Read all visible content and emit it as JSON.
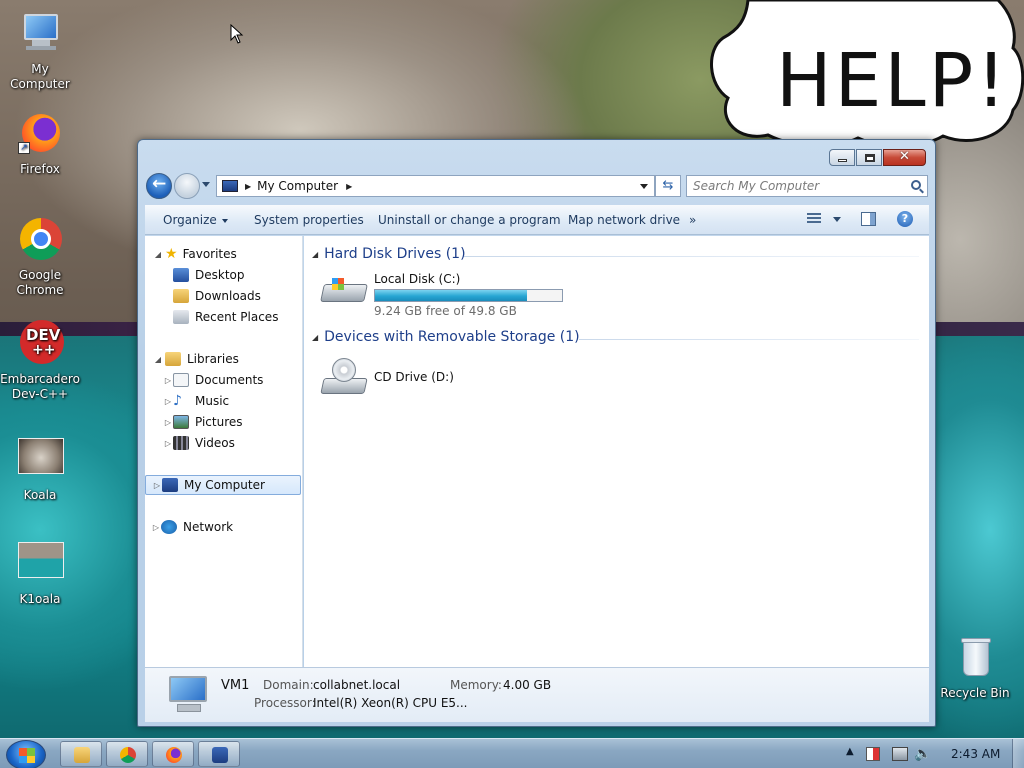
{
  "desktop": {
    "icons": [
      {
        "label": "My Computer"
      },
      {
        "label": "Firefox"
      },
      {
        "label": "Google Chrome"
      },
      {
        "label": "Embarcadero Dev-C++"
      },
      {
        "label": "Koala"
      },
      {
        "label": "K1oala"
      },
      {
        "label": "Recycle Bin"
      }
    ],
    "dev_badge": "DEV",
    "dev_badge2": "++",
    "help_text": "HELP!"
  },
  "window": {
    "address": {
      "location": "My Computer",
      "search_placeholder": "Search My Computer"
    },
    "command_bar": {
      "organize": "Organize",
      "system_properties": "System properties",
      "uninstall": "Uninstall or change a program",
      "map_drive": "Map network drive",
      "more": "»"
    },
    "nav_pane": {
      "favorites": "Favorites",
      "desktop": "Desktop",
      "downloads": "Downloads",
      "recent_places": "Recent Places",
      "libraries": "Libraries",
      "documents": "Documents",
      "music": "Music",
      "pictures": "Pictures",
      "videos": "Videos",
      "my_computer": "My Computer",
      "network": "Network"
    },
    "content": {
      "hard_disk_group": "Hard Disk Drives (1)",
      "removable_group": "Devices with Removable Storage (1)",
      "local_disk": {
        "name": "Local Disk (C:)",
        "free_text": "9.24 GB free of 49.8 GB",
        "used_fraction": 0.814
      },
      "cd_drive": {
        "name": "CD Drive (D:)"
      }
    },
    "details": {
      "name": "VM1",
      "domain_label": "Domain:",
      "domain_value": "collabnet.local",
      "memory_label": "Memory:",
      "memory_value": "4.00 GB",
      "processor_label": "Processor:",
      "processor_value": "Intel(R) Xeon(R) CPU E5..."
    }
  },
  "taskbar": {
    "clock": "2:43 AM",
    "tray_arrow": "▲"
  },
  "colors": {
    "accent": "#1e3f8a",
    "drive_fill": "#27a6d3"
  }
}
